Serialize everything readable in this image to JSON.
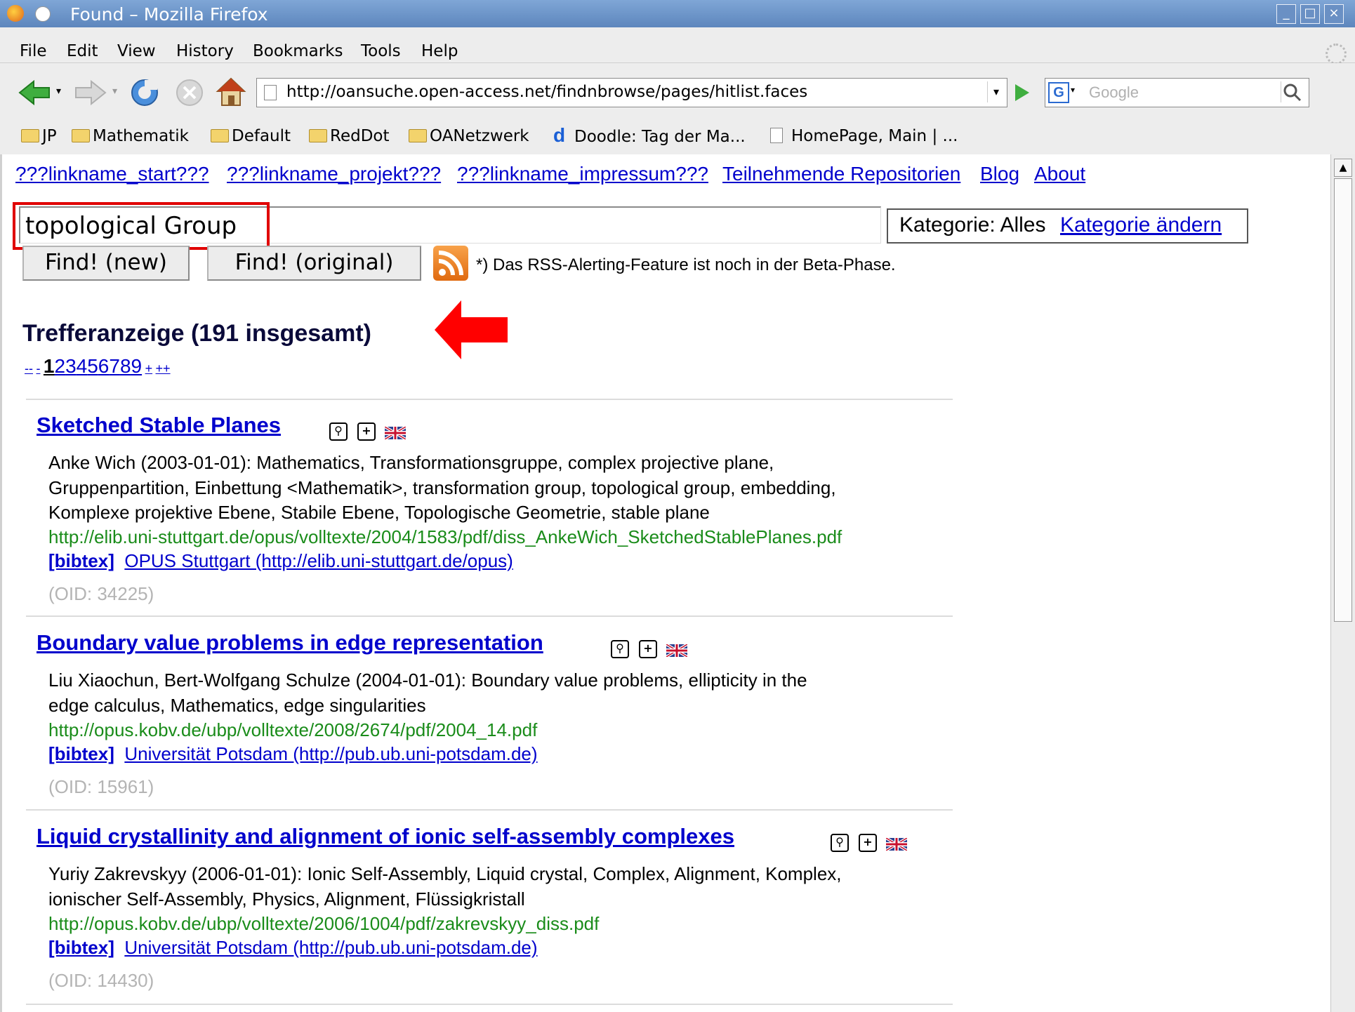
{
  "window": {
    "title": "Found – Mozilla Firefox"
  },
  "menu": [
    "File",
    "Edit",
    "View",
    "History",
    "Bookmarks",
    "Tools",
    "Help"
  ],
  "navbar": {
    "url": "http://oansuche.open-access.net/findnbrowse/pages/hitlist.faces",
    "search_placeholder": "Google"
  },
  "bookmarks": [
    "JP",
    "Mathematik",
    "Default",
    "RedDot",
    "OANetzwerk",
    "Doodle: Tag der Ma...",
    "HomePage, Main | ..."
  ],
  "top_links": [
    "???linkname_start???",
    "???linkname_projekt???",
    "???linkname_impressum???",
    "Teilnehmende Repositorien",
    "Blog",
    "About"
  ],
  "search": {
    "query": "topological Group",
    "category_label": "Kategorie: Alles",
    "category_change": "Kategorie ändern",
    "find_new": "Find! (new)",
    "find_original": "Find! (original)",
    "rss_note": "*) Das RSS-Alerting-Feature ist noch in der Beta-Phase."
  },
  "results_header": "Trefferanzeige (191 insgesamt)",
  "pagination": {
    "first": "--",
    "prev": "-",
    "current": "1",
    "pages": [
      "2",
      "3",
      "4",
      "5",
      "6",
      "7",
      "8",
      "9"
    ],
    "next": "+",
    "last": "++"
  },
  "results": [
    {
      "title": "Sketched Stable Planes",
      "meta_lines": [
        "Anke Wich (2003-01-01):  Mathematics, Transformationsgruppe, complex projective plane,",
        "Gruppenpartition, Einbettung <Mathematik>, transformation group, topological group, embedding,",
        "Komplexe projektive Ebene, Stabile Ebene, Topologische Geometrie, stable plane"
      ],
      "url": "http://elib.uni-stuttgart.de/opus/volltexte/2004/1583/pdf/diss_AnkeWich_SketchedStablePlanes.pdf",
      "bibtex": "[bibtex]",
      "repository": "OPUS Stuttgart (http://elib.uni-stuttgart.de/opus)",
      "oid": "(OID: 34225)"
    },
    {
      "title": "Boundary value problems in edge representation",
      "meta_lines": [
        "Liu Xiaochun, Bert-Wolfgang Schulze (2004-01-01):  Boundary value problems, ellipticity in the",
        "edge calculus, Mathematics, edge singularities"
      ],
      "url": "http://opus.kobv.de/ubp/volltexte/2008/2674/pdf/2004_14.pdf",
      "bibtex": "[bibtex]",
      "repository": "Universität Potsdam (http://pub.ub.uni-potsdam.de)",
      "oid": "(OID: 15961)"
    },
    {
      "title": "Liquid crystallinity and alignment of ionic self-assembly complexes",
      "meta_lines": [
        "Yuriy Zakrevskyy (2006-01-01):  Ionic Self-Assembly, Liquid crystal, Complex, Alignment, Komplex,",
        "ionischer Self-Assembly, Physics, Alignment, Flüssigkristall"
      ],
      "url": "http://opus.kobv.de/ubp/volltexte/2006/1004/pdf/zakrevskyy_diss.pdf",
      "bibtex": "[bibtex]",
      "repository": "Universität Potsdam (http://pub.ub.uni-potsdam.de)",
      "oid": "(OID: 14430)"
    }
  ],
  "colors": {
    "link": "#0000cc",
    "url_green": "#1a8c1a",
    "highlight_red": "#ff0000"
  }
}
